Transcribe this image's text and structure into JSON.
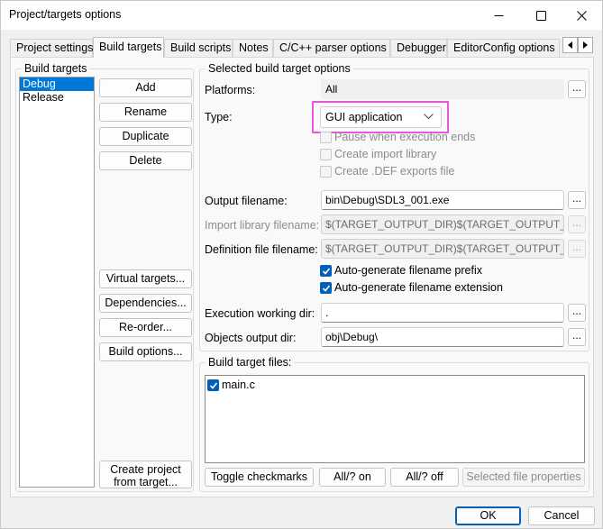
{
  "window": {
    "title": "Project/targets options"
  },
  "tabs": [
    {
      "label": "Project settings"
    },
    {
      "label": "Build targets"
    },
    {
      "label": "Build scripts"
    },
    {
      "label": "Notes"
    },
    {
      "label": "C/C++ parser options"
    },
    {
      "label": "Debugger"
    },
    {
      "label": "EditorConfig options"
    }
  ],
  "active_tab": "Build targets",
  "build_targets": {
    "group_label": "Build targets",
    "items": [
      "Debug",
      "Release"
    ],
    "selected": "Debug",
    "buttons": {
      "add": "Add",
      "rename": "Rename",
      "duplicate": "Duplicate",
      "delete": "Delete",
      "virtual_targets": "Virtual targets...",
      "dependencies": "Dependencies...",
      "reorder": "Re-order...",
      "build_options": "Build options...",
      "create_project_line1": "Create project",
      "create_project_line2": "from target..."
    }
  },
  "selected_options": {
    "group_label": "Selected build target options",
    "platforms_label": "Platforms:",
    "platforms_value": "All",
    "type_label": "Type:",
    "type_value": "GUI application",
    "pause_when_ends": "Pause when execution ends",
    "create_import_library": "Create import library",
    "create_def_exports": "Create .DEF exports file",
    "output_filename_label": "Output filename:",
    "output_filename_value": "bin\\Debug\\SDL3_001.exe",
    "import_library_label": "Import library filename:",
    "import_library_value": "$(TARGET_OUTPUT_DIR)$(TARGET_OUTPUT_BASENAME)",
    "definition_file_label": "Definition file filename:",
    "definition_file_value": "$(TARGET_OUTPUT_DIR)$(TARGET_OUTPUT_BASENAME)",
    "auto_prefix": "Auto-generate filename prefix",
    "auto_extension": "Auto-generate filename extension",
    "exec_dir_label": "Execution working dir:",
    "exec_dir_value": ".",
    "objects_dir_label": "Objects output dir:",
    "objects_dir_value": "obj\\Debug\\",
    "browse_label": "..."
  },
  "target_files": {
    "group_label": "Build target files:",
    "files": [
      "main.c"
    ],
    "toggle_checkmarks": "Toggle checkmarks",
    "all_on": "All/? on",
    "all_off": "All/? off",
    "file_properties": "Selected file properties"
  },
  "footer": {
    "ok": "OK",
    "cancel": "Cancel"
  },
  "colors": {
    "accent": "#005fb8",
    "selection": "#0078d7",
    "highlight": "#e657e0"
  }
}
